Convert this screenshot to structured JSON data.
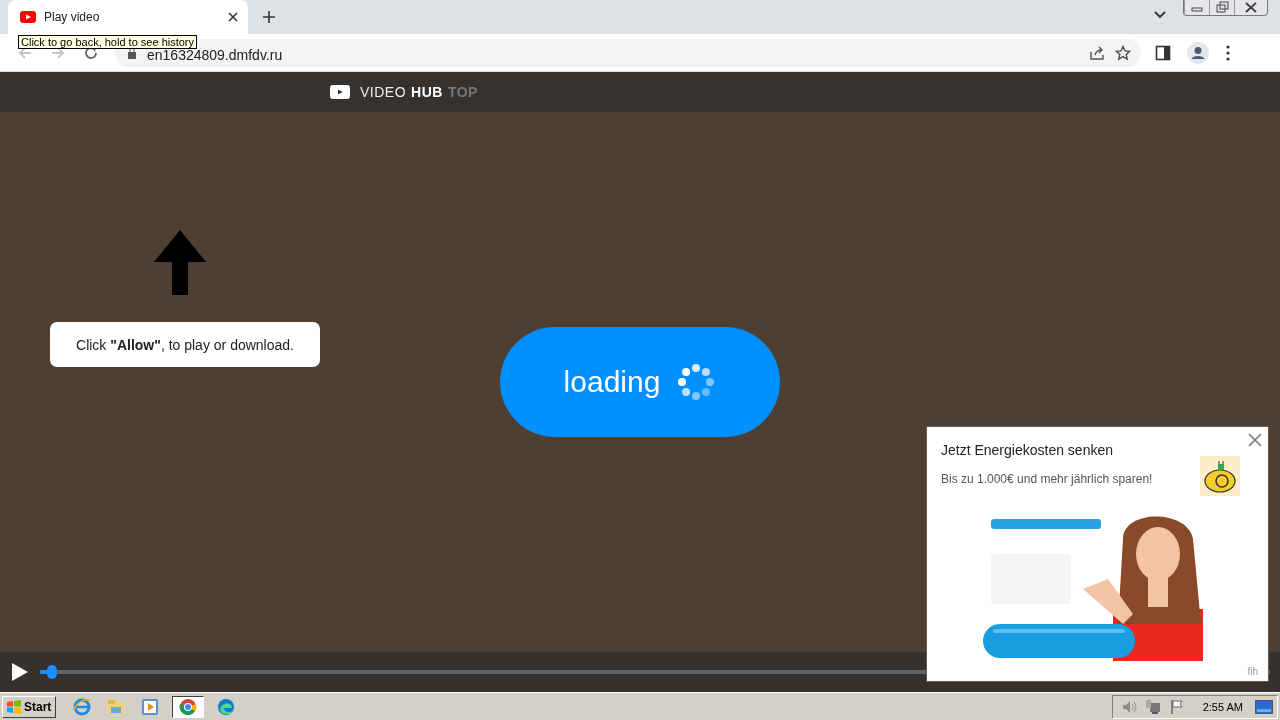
{
  "browser": {
    "tabs": [
      {
        "title": "Play video",
        "selected": true
      }
    ],
    "address": "en16324809.dmfdv.ru",
    "tooltip": "Click to go back, hold to see history"
  },
  "site": {
    "brand": [
      {
        "text": "VIDEO",
        "kind": "light"
      },
      {
        "text": "HUB",
        "kind": "bold"
      },
      {
        "text": "TOP",
        "kind": "muted"
      }
    ]
  },
  "prompt": {
    "message": "Click **\"Allow\"**, to play or download."
  },
  "loader": {
    "label": "loading"
  },
  "player": {
    "playing": false,
    "level": 0.01
  },
  "ad": {
    "title": "Jetzt Energiekosten senken",
    "subtitle": "Bis zu 1.000€ und mehr jährlich sparen!",
    "footer": "fih"
  },
  "taskbar": {
    "start": "Start",
    "apps": [
      {
        "kind": "ie",
        "selected": false
      },
      {
        "kind": "explorer",
        "selected": false
      },
      {
        "kind": "media",
        "selected": false
      },
      {
        "kind": "chrome",
        "selected": true
      },
      {
        "kind": "edge",
        "selected": false
      }
    ],
    "clock": "2:55 AM"
  }
}
